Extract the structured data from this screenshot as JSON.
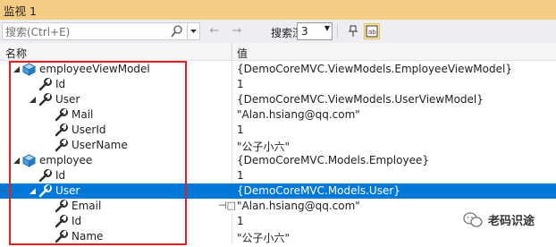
{
  "window": {
    "title": "监视 1"
  },
  "toolbar": {
    "search_placeholder": "搜索(Ctrl+E)",
    "back_arrow": "←",
    "forward_arrow": "→",
    "depth_label": "搜索深度:",
    "depth_value": "3",
    "icons": [
      "search-icon",
      "pin-icon",
      "hex-display-icon"
    ]
  },
  "columns": {
    "name": "名称",
    "value": "值"
  },
  "rows": [
    {
      "name": "employeeViewModel",
      "value": "{DemoCoreMVC.ViewModels.EmployeeViewModel}",
      "icon": "object-icon",
      "expanded": true
    },
    {
      "name": "Id",
      "value": "1",
      "icon": "property-icon",
      "expanded": null
    },
    {
      "name": "User",
      "value": "{DemoCoreMVC.ViewModels.UserViewModel}",
      "icon": "property-icon",
      "expanded": true
    },
    {
      "name": "Mail",
      "value": "\"Alan.hsiang@qq.com\"",
      "icon": "property-icon",
      "expanded": null
    },
    {
      "name": "UserId",
      "value": "1",
      "icon": "property-icon",
      "expanded": null
    },
    {
      "name": "UserName",
      "value": "\"公子小六\"",
      "icon": "property-icon",
      "expanded": null
    },
    {
      "name": "employee",
      "value": "{DemoCoreMVC.Models.Employee}",
      "icon": "object-icon",
      "expanded": true
    },
    {
      "name": "Id",
      "value": "1",
      "icon": "property-icon",
      "expanded": null
    },
    {
      "name": "User",
      "value": "{DemoCoreMVC.Models.User}",
      "icon": "property-icon",
      "expanded": true,
      "selected": true
    },
    {
      "name": "Email",
      "value": "\"Alan.hsiang@qq.com\"",
      "icon": "property-icon",
      "expanded": null,
      "pinned": true
    },
    {
      "name": "Id",
      "value": "1",
      "icon": "property-icon",
      "expanded": null
    },
    {
      "name": "Name",
      "value": "\"公子小六\"",
      "icon": "property-icon",
      "expanded": null
    }
  ],
  "watermark": {
    "text": "老码识途"
  },
  "colors": {
    "title_bar": "#f5cc84",
    "selection": "#0078d7",
    "highlight_box": "#e02020"
  }
}
